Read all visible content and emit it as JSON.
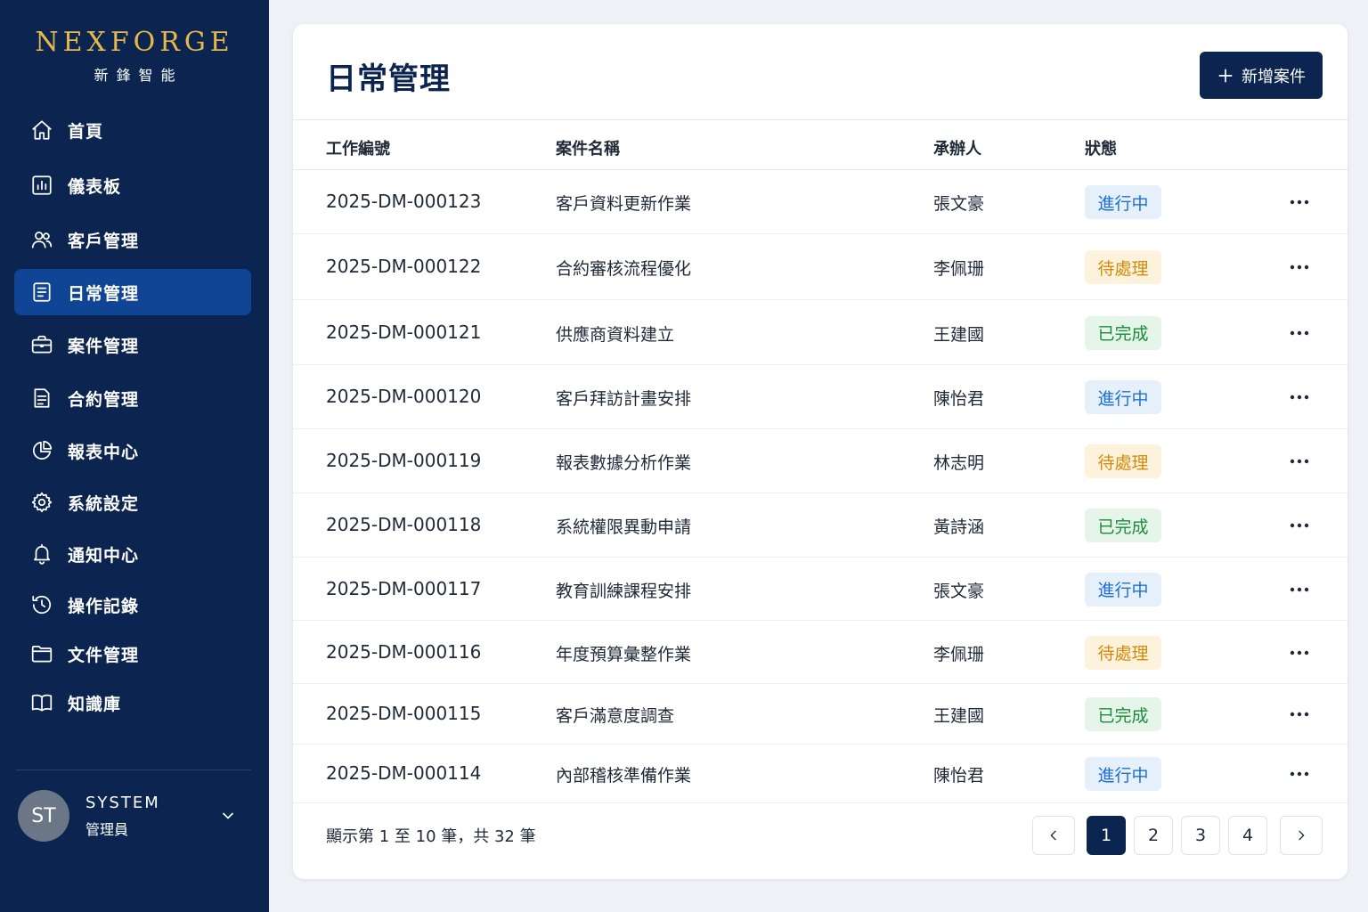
{
  "brand": {
    "name_en": "NEXFORGE",
    "name_zh": "新鋒智能",
    "accent_color": "#e5b84a"
  },
  "sidebar": {
    "items": [
      {
        "label": "首頁",
        "icon": "home-icon",
        "active": false
      },
      {
        "label": "儀表板",
        "icon": "dashboard-chart-icon",
        "active": false
      },
      {
        "label": "客戶管理",
        "icon": "users-icon",
        "active": false
      },
      {
        "label": "日常管理",
        "icon": "document-list-icon",
        "active": true
      },
      {
        "label": "案件管理",
        "icon": "briefcase-icon",
        "active": false
      },
      {
        "label": "合約管理",
        "icon": "contract-document-icon",
        "active": false
      },
      {
        "label": "報表中心",
        "icon": "pie-chart-icon",
        "active": false
      },
      {
        "label": "系統設定",
        "icon": "gear-icon",
        "active": false
      },
      {
        "label": "通知中心",
        "icon": "bell-icon",
        "active": false
      },
      {
        "label": "操作記錄",
        "icon": "history-icon",
        "active": false
      },
      {
        "label": "文件管理",
        "icon": "folder-icon",
        "active": false
      },
      {
        "label": "知識庫",
        "icon": "book-icon",
        "active": false
      }
    ]
  },
  "user": {
    "initials": "ST",
    "name": "SYSTEM",
    "role": "管理員"
  },
  "main": {
    "title": "日常管理",
    "add_button_label": "新增案件",
    "columns": [
      "工作編號",
      "案件名稱",
      "承辦人",
      "狀態"
    ],
    "rows": [
      {
        "id": "2025-DM-000123",
        "name": "客戶資料更新作業",
        "owner": "張文豪",
        "status": "進行中",
        "status_type": "progress"
      },
      {
        "id": "2025-DM-000122",
        "name": "合約審核流程優化",
        "owner": "李佩珊",
        "status": "待處理",
        "status_type": "pending"
      },
      {
        "id": "2025-DM-000121",
        "name": "供應商資料建立",
        "owner": "王建國",
        "status": "已完成",
        "status_type": "done"
      },
      {
        "id": "2025-DM-000120",
        "name": "客戶拜訪計畫安排",
        "owner": "陳怡君",
        "status": "進行中",
        "status_type": "progress"
      },
      {
        "id": "2025-DM-000119",
        "name": "報表數據分析作業",
        "owner": "林志明",
        "status": "待處理",
        "status_type": "pending"
      },
      {
        "id": "2025-DM-000118",
        "name": "系統權限異動申請",
        "owner": "黃詩涵",
        "status": "已完成",
        "status_type": "done"
      },
      {
        "id": "2025-DM-000117",
        "name": "教育訓練課程安排",
        "owner": "張文豪",
        "status": "進行中",
        "status_type": "progress"
      },
      {
        "id": "2025-DM-000116",
        "name": "年度預算彙整作業",
        "owner": "李佩珊",
        "status": "待處理",
        "status_type": "pending"
      },
      {
        "id": "2025-DM-000115",
        "name": "客戶滿意度調查",
        "owner": "王建國",
        "status": "已完成",
        "status_type": "done"
      },
      {
        "id": "2025-DM-000114",
        "name": "內部稽核準備作業",
        "owner": "陳怡君",
        "status": "進行中",
        "status_type": "progress"
      }
    ]
  },
  "pagination": {
    "summary": "顯示第 1 至 10 筆，共 32 筆",
    "pages": [
      "1",
      "2",
      "3",
      "4"
    ],
    "current": "1"
  },
  "status_colors": {
    "progress": {
      "text": "#1d6fd6",
      "bg": "#e6f0fb"
    },
    "pending": {
      "text": "#d58a0d",
      "bg": "#fdf3dc"
    },
    "done": {
      "text": "#1e8a3c",
      "bg": "#e5f5e9"
    }
  }
}
